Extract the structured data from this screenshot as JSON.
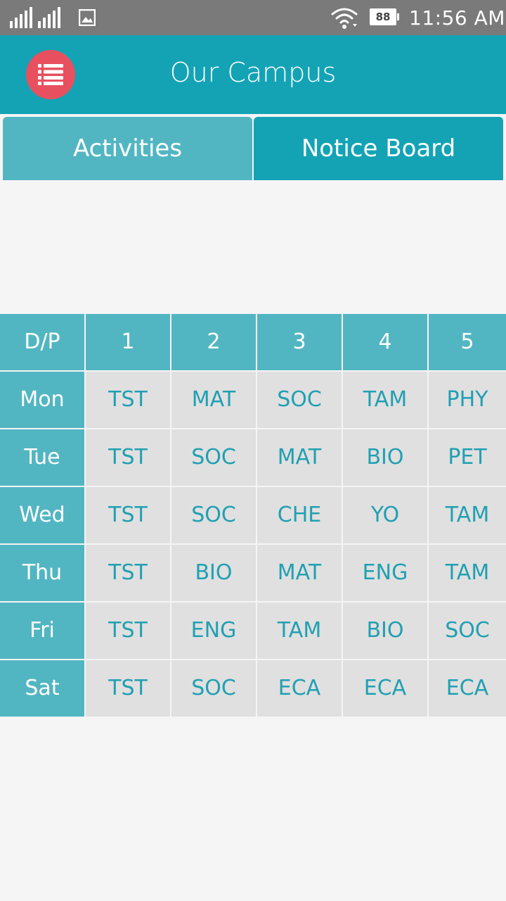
{
  "status_bar": {
    "battery": "88",
    "time": "11:56 AM",
    "icons": [
      "signal-icon",
      "image-icon",
      "wifi-icon",
      "battery-icon"
    ]
  },
  "app_bar": {
    "title": "Our Campus",
    "menu_icon": "list-icon",
    "menu_color": "#e8505f",
    "bar_color": "#13a3b5"
  },
  "tabs": [
    {
      "label": "Activities",
      "selected": false
    },
    {
      "label": "Notice Board",
      "selected": true
    }
  ],
  "timetable": {
    "header": [
      "D/P",
      "1",
      "2",
      "3",
      "4",
      "5"
    ],
    "rows": [
      {
        "day": "Mon",
        "periods": [
          "TST",
          "MAT",
          "SOC",
          "TAM",
          "PHY"
        ]
      },
      {
        "day": "Tue",
        "periods": [
          "TST",
          "SOC",
          "MAT",
          "BIO",
          "PET"
        ]
      },
      {
        "day": "Wed",
        "periods": [
          "TST",
          "SOC",
          "CHE",
          "YO",
          "TAM"
        ]
      },
      {
        "day": "Thu",
        "periods": [
          "TST",
          "BIO",
          "MAT",
          "ENG",
          "TAM"
        ]
      },
      {
        "day": "Fri",
        "periods": [
          "TST",
          "ENG",
          "TAM",
          "BIO",
          "SOC"
        ]
      },
      {
        "day": "Sat",
        "periods": [
          "TST",
          "SOC",
          "ECA",
          "ECA",
          "ECA"
        ]
      }
    ]
  }
}
